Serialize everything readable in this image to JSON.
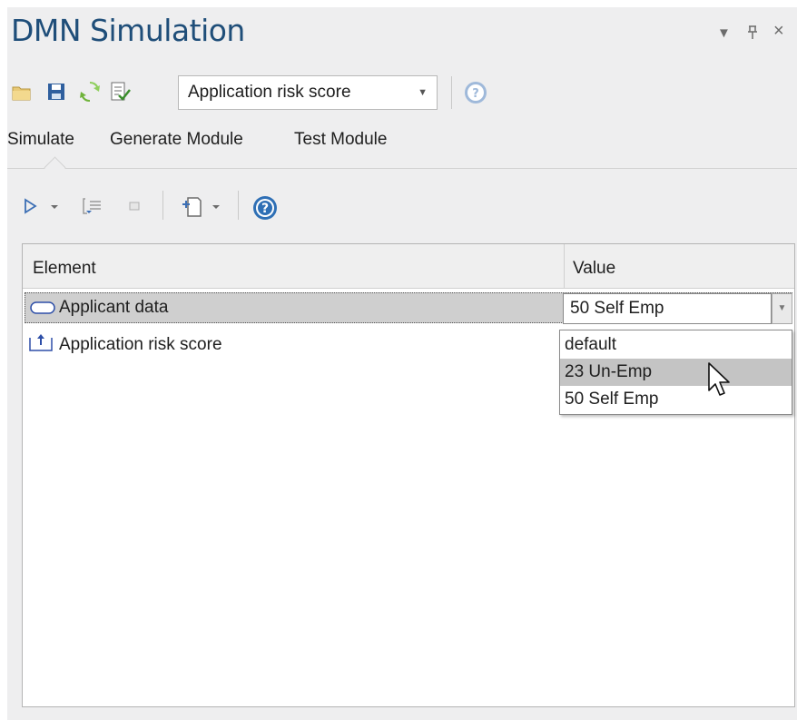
{
  "window": {
    "title": "DMN Simulation",
    "controls": {
      "menu": "▾",
      "pin": "ᵽ",
      "close": "×"
    }
  },
  "toolbar": {
    "icons": [
      "open-folder-icon",
      "save-icon",
      "refresh-icon",
      "checklist-icon"
    ],
    "combo_value": "Application risk score",
    "help_icon": "help-icon"
  },
  "tabs": [
    {
      "label": "Simulate",
      "active": true
    },
    {
      "label": "Generate Module",
      "active": false
    },
    {
      "label": "Test Module",
      "active": false
    }
  ],
  "sub_toolbar": {
    "icons": [
      "run-icon",
      "step-icon",
      "stop-icon",
      "export-icon",
      "help-icon"
    ]
  },
  "grid": {
    "columns": [
      "Element",
      "Value"
    ],
    "rows": [
      {
        "element": "Applicant data",
        "icon": "input-data-icon",
        "value": "50 Self Emp",
        "selected": true
      },
      {
        "element": "Application risk score",
        "icon": "decision-output-icon",
        "value": "",
        "selected": false
      }
    ]
  },
  "dropdown": {
    "options": [
      "default",
      "23 Un-Emp",
      "50 Self Emp"
    ],
    "hovered": "23 Un-Emp"
  },
  "colors": {
    "title": "#1f4e79",
    "panel_bg": "#eeeeef",
    "selected_row": "#cfcfcf",
    "hover_option": "#c4c4c4",
    "help_icon": "#2e6fb5"
  }
}
